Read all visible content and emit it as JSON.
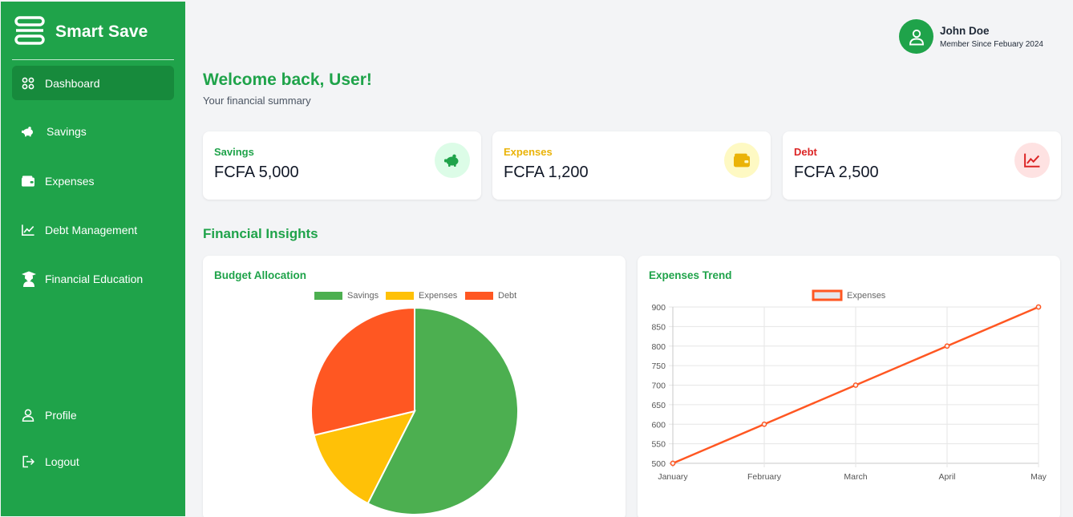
{
  "app": {
    "name": "Smart Save"
  },
  "sidebar": {
    "items": [
      {
        "label": "Dashboard",
        "icon": "grid-icon"
      },
      {
        "label": "Savings",
        "icon": "piggy-bank-icon"
      },
      {
        "label": "Expenses",
        "icon": "wallet-icon"
      },
      {
        "label": "Debt Management",
        "icon": "chart-line-icon"
      },
      {
        "label": "Financial Education",
        "icon": "graduate-icon"
      }
    ],
    "bottom_items": [
      {
        "label": "Profile",
        "icon": "user-icon"
      },
      {
        "label": "Logout",
        "icon": "logout-icon"
      }
    ],
    "active": "Dashboard"
  },
  "user": {
    "name": "John Doe",
    "member_since": "Member Since Febuary 2024"
  },
  "header": {
    "welcome": "Welcome back, User!",
    "subtitle": "Your financial summary"
  },
  "stats": [
    {
      "label": "Savings",
      "value": "FCFA 5,000",
      "color": "#1fa34a",
      "icon_bg": "#dcfce7",
      "icon": "piggy-bank-icon"
    },
    {
      "label": "Expenses",
      "value": "FCFA 1,200",
      "color": "#eab308",
      "icon_bg": "#fef9c3",
      "icon": "wallet-icon"
    },
    {
      "label": "Debt",
      "value": "FCFA 2,500",
      "color": "#dc2626",
      "icon_bg": "#fee2e2",
      "icon": "chart-line-icon"
    }
  ],
  "insights": {
    "title": "Financial Insights"
  },
  "charts": {
    "budget_title": "Budget Allocation",
    "trend_title": "Expenses Trend"
  },
  "chart_data": [
    {
      "type": "pie",
      "title": "Budget Allocation",
      "categories": [
        "Savings",
        "Expenses",
        "Debt"
      ],
      "values": [
        5000,
        1200,
        2500
      ],
      "colors": [
        "#4caf50",
        "#ffc107",
        "#ff5722"
      ],
      "legend": "top"
    },
    {
      "type": "line",
      "title": "Expenses Trend",
      "x": [
        "January",
        "February",
        "March",
        "April",
        "May"
      ],
      "series": [
        {
          "name": "Expenses",
          "values": [
            500,
            600,
            700,
            800,
            900
          ],
          "color": "#ff5722"
        }
      ],
      "ylim": [
        500,
        900
      ],
      "yticks": [
        500,
        550,
        600,
        650,
        700,
        750,
        800,
        850,
        900
      ],
      "grid": true,
      "legend": "top"
    }
  ]
}
